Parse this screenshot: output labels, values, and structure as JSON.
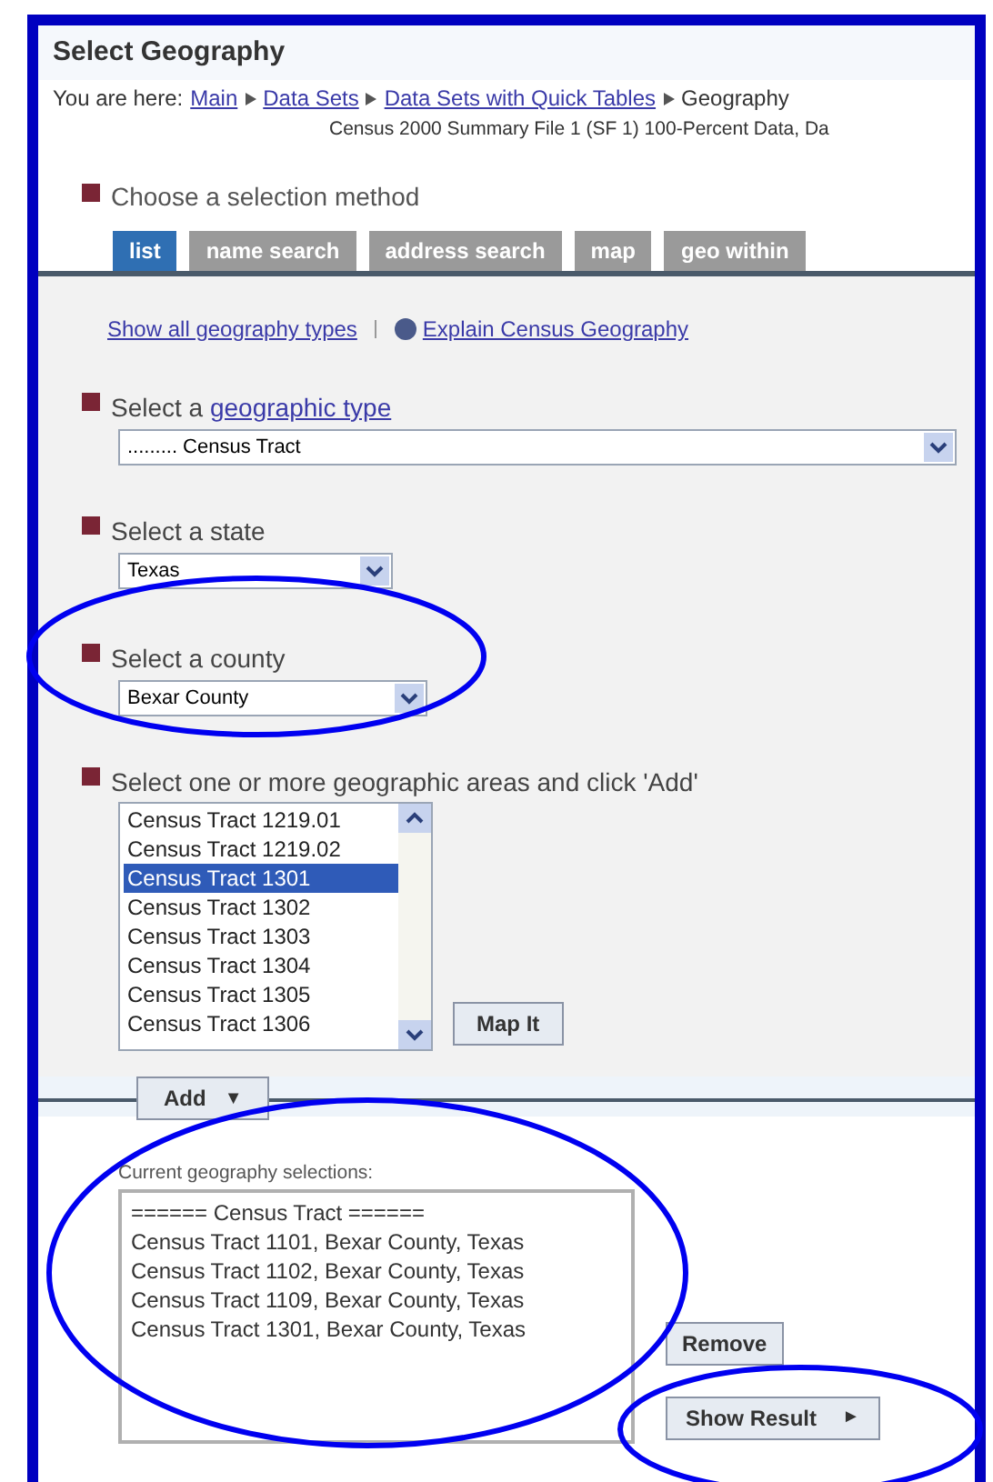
{
  "title": "Select Geography",
  "breadcrumb": {
    "label": "You are here:",
    "items": [
      {
        "text": "Main",
        "link": true
      },
      {
        "text": "Data Sets",
        "link": true
      },
      {
        "text": "Data Sets with Quick Tables",
        "link": true
      },
      {
        "text": "Geography",
        "link": false
      }
    ]
  },
  "dataset": "Census 2000 Summary File 1 (SF 1) 100-Percent Data, Da",
  "method_label": "Choose a selection method",
  "tabs": [
    {
      "label": "list",
      "selected": true
    },
    {
      "label": "name search",
      "selected": false
    },
    {
      "label": "address search",
      "selected": false
    },
    {
      "label": "map",
      "selected": false
    },
    {
      "label": "geo within",
      "selected": false
    }
  ],
  "links": [
    {
      "text": "Show all geography types",
      "kind": "plain"
    },
    {
      "text": "Explain Census Geography",
      "kind": "info"
    }
  ],
  "geo_type": {
    "label": "Select a ",
    "link": "geographic type",
    "value": "......... Census Tract"
  },
  "state": {
    "label": "Select a state",
    "value": "Texas"
  },
  "county": {
    "label": "Select a county",
    "value": "Bexar County"
  },
  "areas": {
    "label": "Select one or more geographic areas and click 'Add'",
    "items": [
      {
        "text": "Census Tract 1219.01",
        "selected": false
      },
      {
        "text": "Census Tract 1219.02",
        "selected": false
      },
      {
        "text": "Census Tract 1301",
        "selected": true
      },
      {
        "text": "Census Tract 1302",
        "selected": false
      },
      {
        "text": "Census Tract 1303",
        "selected": false
      },
      {
        "text": "Census Tract 1304",
        "selected": false
      },
      {
        "text": "Census Tract 1305",
        "selected": false
      },
      {
        "text": "Census Tract 1306",
        "selected": false
      }
    ]
  },
  "map_button": "Map It",
  "add_button": "Add",
  "add_arrow": "▼",
  "selections": {
    "label": "Current geography selections:",
    "items": [
      "====== Census Tract ======",
      "Census Tract 1101, Bexar County, Texas",
      "Census Tract 1102, Bexar County, Texas",
      "Census Tract 1109, Bexar County, Texas",
      "Census Tract 1301, Bexar County, Texas"
    ]
  },
  "remove_button": "Remove",
  "show_button": "Show Result",
  "show_arrow": "►"
}
